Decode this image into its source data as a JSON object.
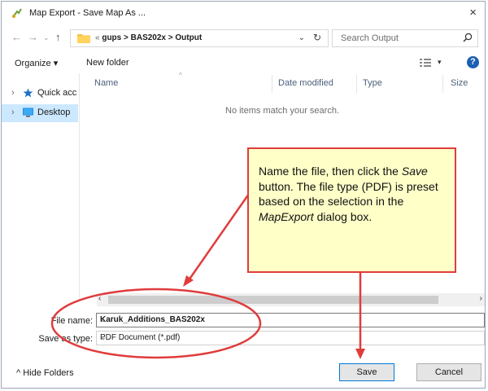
{
  "window": {
    "title": "Map Export - Save Map As ...",
    "close_glyph": "×"
  },
  "address_bar": {
    "breadcrumb_prefix": "«",
    "breadcrumb": "gups > BAS202x > Output",
    "dropdown_glyph": "⌄",
    "refresh_glyph": "↻"
  },
  "search": {
    "placeholder": "Search Output"
  },
  "toolbar": {
    "organize_label": "Organize ▾",
    "new_folder_label": "New folder",
    "help_label": "?"
  },
  "nav_pane": {
    "items": [
      {
        "label": "Quick acc",
        "icon": "star-icon"
      },
      {
        "label": "Desktop",
        "icon": "desktop-icon"
      }
    ]
  },
  "file_list": {
    "columns": [
      "Name",
      "Date modified",
      "Type",
      "Size"
    ],
    "empty_message": "No items match your search."
  },
  "form": {
    "file_name_label": "File name:",
    "file_name_value": "Karuk_Additions_BAS202x",
    "save_type_label": "Save as type:",
    "save_type_value": "PDF Document (*.pdf)"
  },
  "buttons": {
    "hide_folders": "Hide Folders",
    "save": "Save",
    "cancel": "Cancel"
  },
  "callout": {
    "text_part1": "Name the file, then click the ",
    "text_save": "Save",
    "text_part2": " button. The file type (PDF) is preset based on the selection in the ",
    "text_mapexport": "MapExport",
    "text_part3": " dialog box."
  },
  "colors": {
    "accent": "#0078d7",
    "annotation_red": "#e03c3c",
    "callout_fill": "#ffffc8",
    "selected_bg": "#cce8ff"
  }
}
